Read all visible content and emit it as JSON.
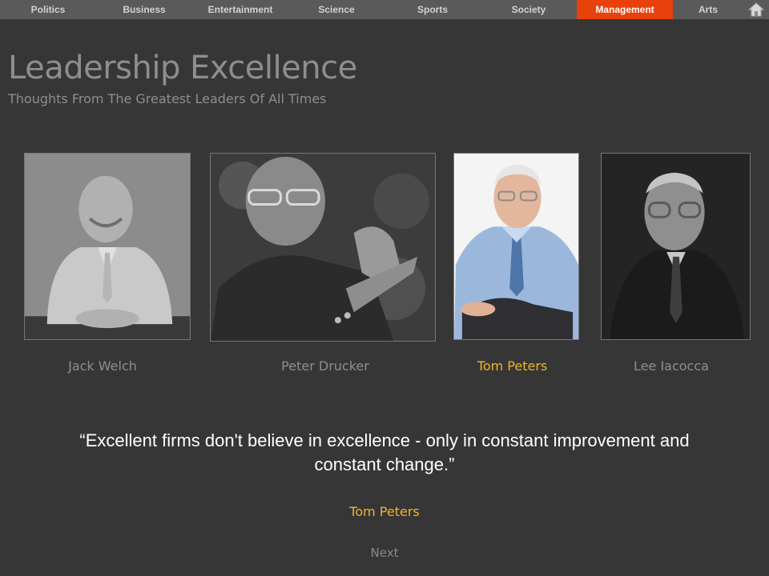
{
  "nav": {
    "items": [
      "Politics",
      "Business",
      "Entertainment",
      "Science",
      "Sports",
      "Society",
      "Management",
      "Arts"
    ],
    "active": "Management",
    "home_icon": "home-icon"
  },
  "header": {
    "title": "Leadership Excellence",
    "subtitle": "Thoughts From The Greatest Leaders Of All Times"
  },
  "leaders": [
    {
      "name": "Jack Welch",
      "selected": false
    },
    {
      "name": "Peter Drucker",
      "selected": false
    },
    {
      "name": "Tom Peters",
      "selected": true
    },
    {
      "name": "Lee Iacocca",
      "selected": false
    }
  ],
  "quote": {
    "text": "“Excellent firms don't believe in excellence - only in constant improvement and constant change.”",
    "author": "Tom Peters"
  },
  "footer": {
    "next_label": "Next"
  },
  "colors": {
    "background": "#363636",
    "nav_bar": "#5a5a5a",
    "nav_active": "#e8410b",
    "highlight": "#f0b52a",
    "muted_text": "#8e8e8e"
  }
}
